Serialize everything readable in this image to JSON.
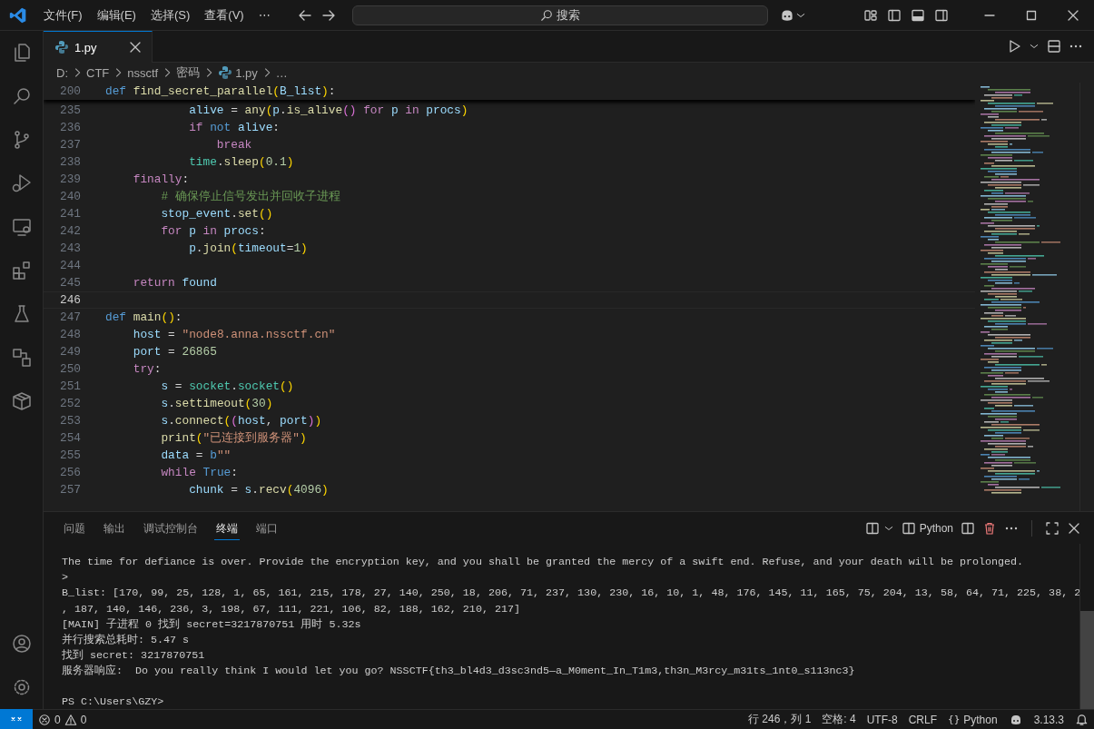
{
  "title_bar": {
    "menus": [
      {
        "label": "文件(F)"
      },
      {
        "label": "编辑(E)"
      },
      {
        "label": "选择(S)"
      },
      {
        "label": "查看(V)"
      },
      {
        "label": "⋯"
      }
    ],
    "search": {
      "placeholder": "搜索"
    }
  },
  "editor": {
    "tabs": [
      {
        "label": "1.py",
        "selected": true
      }
    ],
    "breadcrumbs": [
      "D:",
      "CTF",
      "nssctf",
      "密码",
      "1.py",
      "…"
    ],
    "sticky_line": {
      "number": "200",
      "tokens": [
        {
          "text": "def",
          "kind": "kw"
        },
        {
          "text": " find_secret_parallel",
          "kind": "fn"
        },
        {
          "text": "(",
          "kind": "br1"
        },
        {
          "text": "B_list",
          "kind": "var"
        },
        {
          "text": ")",
          "kind": "br1"
        },
        {
          "text": ":",
          "kind": "op"
        }
      ]
    },
    "lines": [
      {
        "number": "235",
        "current": false,
        "tokens": [
          {
            "text": "            alive",
            "kind": "var"
          },
          {
            "text": " = ",
            "kind": "op"
          },
          {
            "text": "any",
            "kind": "fn"
          },
          {
            "text": "(",
            "kind": "br1"
          },
          {
            "text": "p",
            "kind": "var"
          },
          {
            "text": ".",
            "kind": "op"
          },
          {
            "text": "is_alive",
            "kind": "fn"
          },
          {
            "text": "()",
            "kind": "br2"
          },
          {
            "text": " for",
            "kind": "ctl"
          },
          {
            "text": " p ",
            "kind": "var"
          },
          {
            "text": "in",
            "kind": "ctl"
          },
          {
            "text": " procs",
            "kind": "var"
          },
          {
            "text": ")",
            "kind": "br1"
          }
        ]
      },
      {
        "number": "236",
        "current": false,
        "tokens": [
          {
            "text": "            if",
            "kind": "ctl"
          },
          {
            "text": " not",
            "kind": "kw"
          },
          {
            "text": " alive",
            "kind": "var"
          },
          {
            "text": ":",
            "kind": "op"
          }
        ]
      },
      {
        "number": "237",
        "current": false,
        "tokens": [
          {
            "text": "                break",
            "kind": "ctl"
          }
        ]
      },
      {
        "number": "238",
        "current": false,
        "tokens": [
          {
            "text": "            time",
            "kind": "cls"
          },
          {
            "text": ".",
            "kind": "op"
          },
          {
            "text": "sleep",
            "kind": "fn"
          },
          {
            "text": "(",
            "kind": "br1"
          },
          {
            "text": "0.1",
            "kind": "num"
          },
          {
            "text": ")",
            "kind": "br1"
          }
        ]
      },
      {
        "number": "239",
        "current": false,
        "tokens": [
          {
            "text": "    finally",
            "kind": "ctl"
          },
          {
            "text": ":",
            "kind": "op"
          }
        ]
      },
      {
        "number": "240",
        "current": false,
        "tokens": [
          {
            "text": "        # 确保停止信号发出并回收子进程",
            "kind": "cmt"
          }
        ]
      },
      {
        "number": "241",
        "current": false,
        "tokens": [
          {
            "text": "        stop_event",
            "kind": "var"
          },
          {
            "text": ".",
            "kind": "op"
          },
          {
            "text": "set",
            "kind": "fn"
          },
          {
            "text": "()",
            "kind": "br1"
          }
        ]
      },
      {
        "number": "242",
        "current": false,
        "tokens": [
          {
            "text": "        for",
            "kind": "ctl"
          },
          {
            "text": " p ",
            "kind": "var"
          },
          {
            "text": "in",
            "kind": "ctl"
          },
          {
            "text": " procs",
            "kind": "var"
          },
          {
            "text": ":",
            "kind": "op"
          }
        ]
      },
      {
        "number": "243",
        "current": false,
        "tokens": [
          {
            "text": "            p",
            "kind": "var"
          },
          {
            "text": ".",
            "kind": "op"
          },
          {
            "text": "join",
            "kind": "fn"
          },
          {
            "text": "(",
            "kind": "br1"
          },
          {
            "text": "timeout",
            "kind": "var"
          },
          {
            "text": "=",
            "kind": "op"
          },
          {
            "text": "1",
            "kind": "num"
          },
          {
            "text": ")",
            "kind": "br1"
          }
        ]
      },
      {
        "number": "244",
        "current": false
      },
      {
        "number": "245",
        "current": false,
        "tokens": [
          {
            "text": "    return",
            "kind": "ctl"
          },
          {
            "text": " found",
            "kind": "var"
          }
        ]
      },
      {
        "number": "246",
        "current": true
      },
      {
        "number": "247",
        "current": false,
        "tokens": [
          {
            "text": "def",
            "kind": "kw"
          },
          {
            "text": " main",
            "kind": "fn"
          },
          {
            "text": "()",
            "kind": "br1"
          },
          {
            "text": ":",
            "kind": "op"
          }
        ]
      },
      {
        "number": "248",
        "current": false,
        "tokens": [
          {
            "text": "    host",
            "kind": "var"
          },
          {
            "text": " = ",
            "kind": "op"
          },
          {
            "text": "\"node8.anna.nssctf.cn\"",
            "kind": "str"
          }
        ]
      },
      {
        "number": "249",
        "current": false,
        "tokens": [
          {
            "text": "    port",
            "kind": "var"
          },
          {
            "text": " = ",
            "kind": "op"
          },
          {
            "text": "26865",
            "kind": "num"
          }
        ]
      },
      {
        "number": "250",
        "current": false,
        "tokens": [
          {
            "text": "    try",
            "kind": "ctl"
          },
          {
            "text": ":",
            "kind": "op"
          }
        ]
      },
      {
        "number": "251",
        "current": false,
        "tokens": [
          {
            "text": "        s",
            "kind": "var"
          },
          {
            "text": " = ",
            "kind": "op"
          },
          {
            "text": "socket",
            "kind": "cls"
          },
          {
            "text": ".",
            "kind": "op"
          },
          {
            "text": "socket",
            "kind": "cls"
          },
          {
            "text": "()",
            "kind": "br1"
          }
        ]
      },
      {
        "number": "252",
        "current": false,
        "tokens": [
          {
            "text": "        s",
            "kind": "var"
          },
          {
            "text": ".",
            "kind": "op"
          },
          {
            "text": "settimeout",
            "kind": "fn"
          },
          {
            "text": "(",
            "kind": "br1"
          },
          {
            "text": "30",
            "kind": "num"
          },
          {
            "text": ")",
            "kind": "br1"
          }
        ]
      },
      {
        "number": "253",
        "current": false,
        "tokens": [
          {
            "text": "        s",
            "kind": "var"
          },
          {
            "text": ".",
            "kind": "op"
          },
          {
            "text": "connect",
            "kind": "fn"
          },
          {
            "text": "(",
            "kind": "br1"
          },
          {
            "text": "(",
            "kind": "br2"
          },
          {
            "text": "host",
            "kind": "var"
          },
          {
            "text": ", ",
            "kind": "op"
          },
          {
            "text": "port",
            "kind": "var"
          },
          {
            "text": ")",
            "kind": "br2"
          },
          {
            "text": ")",
            "kind": "br1"
          }
        ]
      },
      {
        "number": "254",
        "current": false,
        "tokens": [
          {
            "text": "        print",
            "kind": "fn"
          },
          {
            "text": "(",
            "kind": "br1"
          },
          {
            "text": "\"已连接到服务器\"",
            "kind": "str"
          },
          {
            "text": ")",
            "kind": "br1"
          }
        ]
      },
      {
        "number": "255",
        "current": false,
        "tokens": [
          {
            "text": "        data",
            "kind": "var"
          },
          {
            "text": " = ",
            "kind": "op"
          },
          {
            "text": "b",
            "kind": "kw"
          },
          {
            "text": "\"\"",
            "kind": "str"
          }
        ]
      },
      {
        "number": "256",
        "current": false,
        "tokens": [
          {
            "text": "        while",
            "kind": "ctl"
          },
          {
            "text": " True",
            "kind": "kw"
          },
          {
            "text": ":",
            "kind": "op"
          }
        ]
      },
      {
        "number": "257",
        "current": false,
        "tokens": [
          {
            "text": "            chunk",
            "kind": "var"
          },
          {
            "text": " = ",
            "kind": "op"
          },
          {
            "text": "s",
            "kind": "var"
          },
          {
            "text": ".",
            "kind": "op"
          },
          {
            "text": "recv",
            "kind": "fn"
          },
          {
            "text": "(",
            "kind": "br1"
          },
          {
            "text": "4096",
            "kind": "num"
          },
          {
            "text": ")",
            "kind": "br1"
          }
        ]
      }
    ]
  },
  "panel": {
    "tabs": [
      {
        "label": "问题",
        "selected": false
      },
      {
        "label": "输出",
        "selected": false
      },
      {
        "label": "调试控制台",
        "selected": false
      },
      {
        "label": "终端",
        "selected": true
      },
      {
        "label": "端口",
        "selected": false
      }
    ],
    "terminal_profile": "Python",
    "output": [
      "The time for defiance is over. Provide the encryption key, and you shall be granted the mercy of a swift end. Refuse, and your death will be prolonged.",
      ">",
      "B_list: [170, 99, 25, 128, 1, 65, 161, 215, 178, 27, 140, 250, 18, 206, 71, 237, 130, 230, 16, 10, 1, 48, 176, 145, 11, 165, 75, 204, 13, 58, 64, 71, 225, 38, 2",
      ", 187, 140, 146, 236, 3, 198, 67, 111, 221, 106, 82, 188, 162, 210, 217]",
      "[MAIN] 子进程 0 找到 secret=3217870751 用时 5.32s",
      "并行搜索总耗时: 5.47 s",
      "找到 secret: 3217870751",
      "服务器响应:  Do you really think I would let you go? NSSCTF{th3_bl4d3_d3sc3nd5—a_M0ment_In_T1m3,th3n_M3rcy_m31ts_1nt0_s113nc3}"
    ],
    "prompt": "PS C:\\Users\\GZY>"
  },
  "status_bar": {
    "errors": "0",
    "warnings": "0",
    "items": [
      {
        "text": "行 246，列 1"
      },
      {
        "text": "空格: 4"
      },
      {
        "text": "UTF-8"
      },
      {
        "text": "CRLF"
      },
      {
        "icon": "{}",
        "text": "Python"
      },
      {
        "kind": "copilot"
      },
      {
        "text": "3.13.3"
      }
    ]
  }
}
